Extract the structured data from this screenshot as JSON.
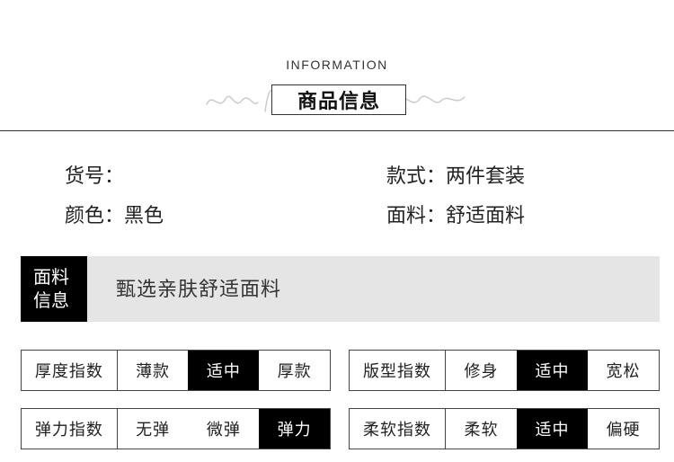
{
  "header": {
    "en_title": "INFORMATION",
    "cn_title": "商品信息"
  },
  "product": {
    "item_no": {
      "label": "货号：",
      "value": ""
    },
    "color": {
      "label": "颜色：",
      "value": "黑色"
    },
    "style": {
      "label": "款式：",
      "value": "两件套装"
    },
    "fabric": {
      "label": "面料：",
      "value": "舒适面料"
    }
  },
  "fabric_info": {
    "label_line1": "面料",
    "label_line2": "信息",
    "text": "甄选亲肤舒适面料"
  },
  "scales": [
    {
      "name": "厚度指数",
      "options": [
        "薄款",
        "适中",
        "厚款"
      ],
      "selected": "适中"
    },
    {
      "name": "版型指数",
      "options": [
        "修身",
        "适中",
        "宽松"
      ],
      "selected": "适中"
    },
    {
      "name": "弹力指数",
      "options": [
        "无弹",
        "微弹",
        "弹力"
      ],
      "selected": "弹力"
    },
    {
      "name": "柔软指数",
      "options": [
        "柔软",
        "适中",
        "偏硬"
      ],
      "selected": "适中"
    }
  ],
  "colors": {
    "selected_bg": "#000000",
    "band_bg": "#e5e5e5",
    "border": "#444444"
  }
}
